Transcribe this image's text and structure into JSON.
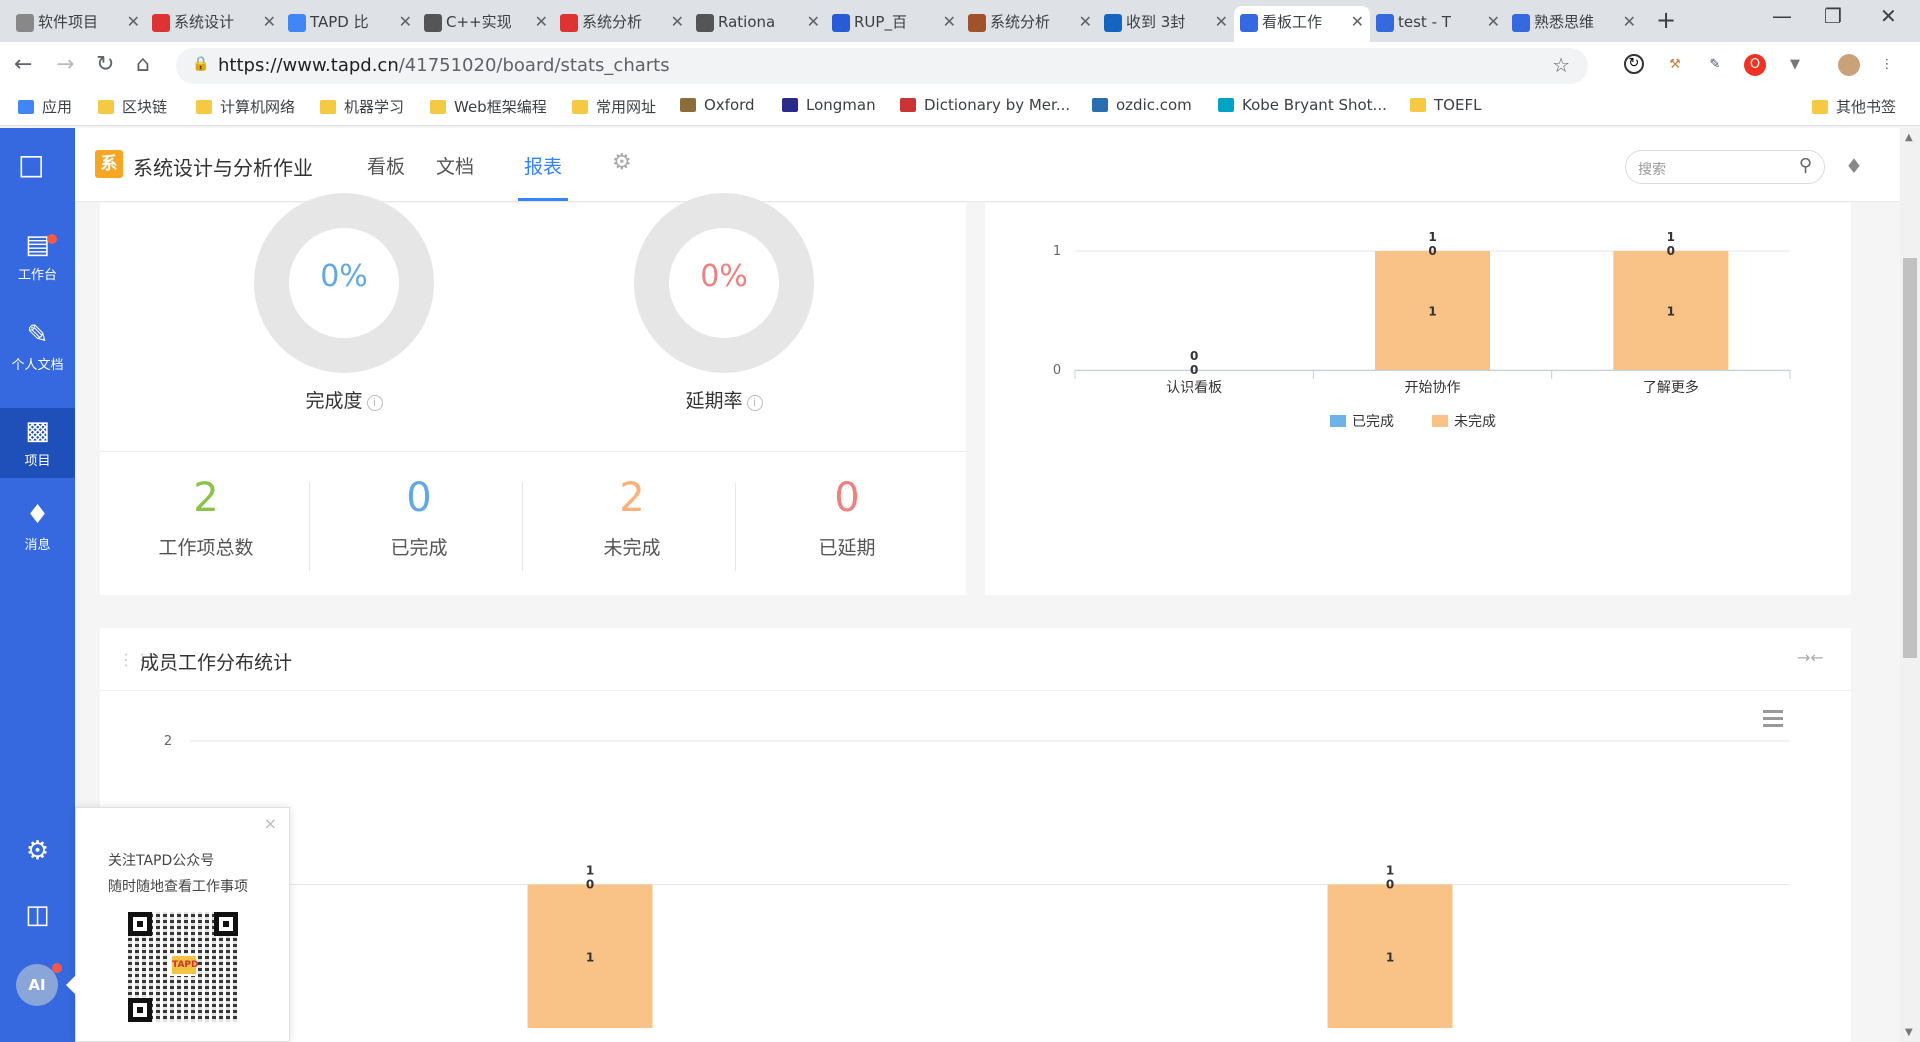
{
  "browser": {
    "tabs": [
      {
        "label": "软件项目",
        "fav_color": "#888"
      },
      {
        "label": "系统设计",
        "fav_color": "#d33"
      },
      {
        "label": "TAPD 比",
        "fav_color": "#4285f4"
      },
      {
        "label": "C++实现",
        "fav_color": "#555"
      },
      {
        "label": "系统分析",
        "fav_color": "#d33"
      },
      {
        "label": "Rationa",
        "fav_color": "#555"
      },
      {
        "label": "RUP_百",
        "fav_color": "#2a5bd7"
      },
      {
        "label": "系统分析",
        "fav_color": "#a0522d"
      },
      {
        "label": "收到 3封",
        "fav_color": "#1565c0"
      },
      {
        "label": "看板工作",
        "fav_color": "#3669e0"
      },
      {
        "label": "test - T",
        "fav_color": "#3669e0"
      },
      {
        "label": "熟悉思维",
        "fav_color": "#3669e0"
      }
    ],
    "active_tab_index": 9,
    "url_host": "https://www.tapd.cn",
    "url_path": "/41751020/board/stats_charts",
    "bookmarks": [
      {
        "label": "应用",
        "color": "#4285f4"
      },
      {
        "label": "区块链",
        "color": "#f6c945"
      },
      {
        "label": "计算机网络",
        "color": "#f6c945"
      },
      {
        "label": "机器学习",
        "color": "#f6c945"
      },
      {
        "label": "Web框架编程",
        "color": "#f6c945"
      },
      {
        "label": "常用网址",
        "color": "#f6c945"
      },
      {
        "label": "Oxford",
        "color": "#8a6d3b"
      },
      {
        "label": "Longman",
        "color": "#2b2b8a"
      },
      {
        "label": "Dictionary by Mer...",
        "color": "#c33"
      },
      {
        "label": "ozdic.com",
        "color": "#2a6db0"
      },
      {
        "label": "Kobe Bryant Shot...",
        "color": "#00a3c4"
      },
      {
        "label": "TOEFL",
        "color": "#f6c945"
      }
    ],
    "other_bookmarks": "其他书签"
  },
  "leftnav": {
    "items": [
      {
        "label": "工作台",
        "icon": "archive-icon"
      },
      {
        "label": "个人文档",
        "icon": "document-icon"
      },
      {
        "label": "项目",
        "icon": "inbox-icon"
      },
      {
        "label": "消息",
        "icon": "bell-icon"
      }
    ],
    "avatar_text": "AI"
  },
  "topnav": {
    "project_badge": "系",
    "project_name": "系统设计与分析作业",
    "tabs": [
      "看板",
      "文档",
      "报表"
    ],
    "active_tab": "报表",
    "search_placeholder": "搜索"
  },
  "overview": {
    "completion_value": "0%",
    "completion_label": "完成度",
    "delay_value": "0%",
    "delay_label": "延期率",
    "stats": [
      {
        "value": "2",
        "label": "工作项总数",
        "color": "#8bc34a"
      },
      {
        "value": "0",
        "label": "已完成",
        "color": "#62a8e8"
      },
      {
        "value": "2",
        "label": "未完成",
        "color": "#f7b27a"
      },
      {
        "value": "0",
        "label": "已延期",
        "color": "#f08080"
      }
    ]
  },
  "colors": {
    "completed": "#6fb2e8",
    "incomplete": "#f9c387"
  },
  "chart_data": [
    {
      "type": "bar",
      "stacked": true,
      "categories": [
        "认识看板",
        "开始协作",
        "了解更多"
      ],
      "series": [
        {
          "name": "已完成",
          "values": [
            0,
            0,
            0
          ]
        },
        {
          "name": "未完成",
          "values": [
            0,
            1,
            1
          ]
        }
      ],
      "totals": [
        0,
        1,
        1
      ],
      "ylim": [
        0,
        1
      ],
      "yticks": [
        0,
        1
      ],
      "legend": "bottom-center",
      "grid": true
    },
    {
      "type": "bar",
      "stacked": true,
      "title": "成员工作分布统计",
      "categories": [
        "",
        ""
      ],
      "series": [
        {
          "name": "已完成",
          "values": [
            0,
            0
          ]
        },
        {
          "name": "未完成",
          "values": [
            1,
            1
          ]
        }
      ],
      "totals": [
        1,
        1
      ],
      "ylim": [
        0,
        2
      ],
      "yticks": [
        2
      ],
      "grid": true
    }
  ],
  "popup": {
    "line1": "关注TAPD公众号",
    "line2": "随时随地查看工作事项",
    "qr_logo_text": "TAPD"
  }
}
